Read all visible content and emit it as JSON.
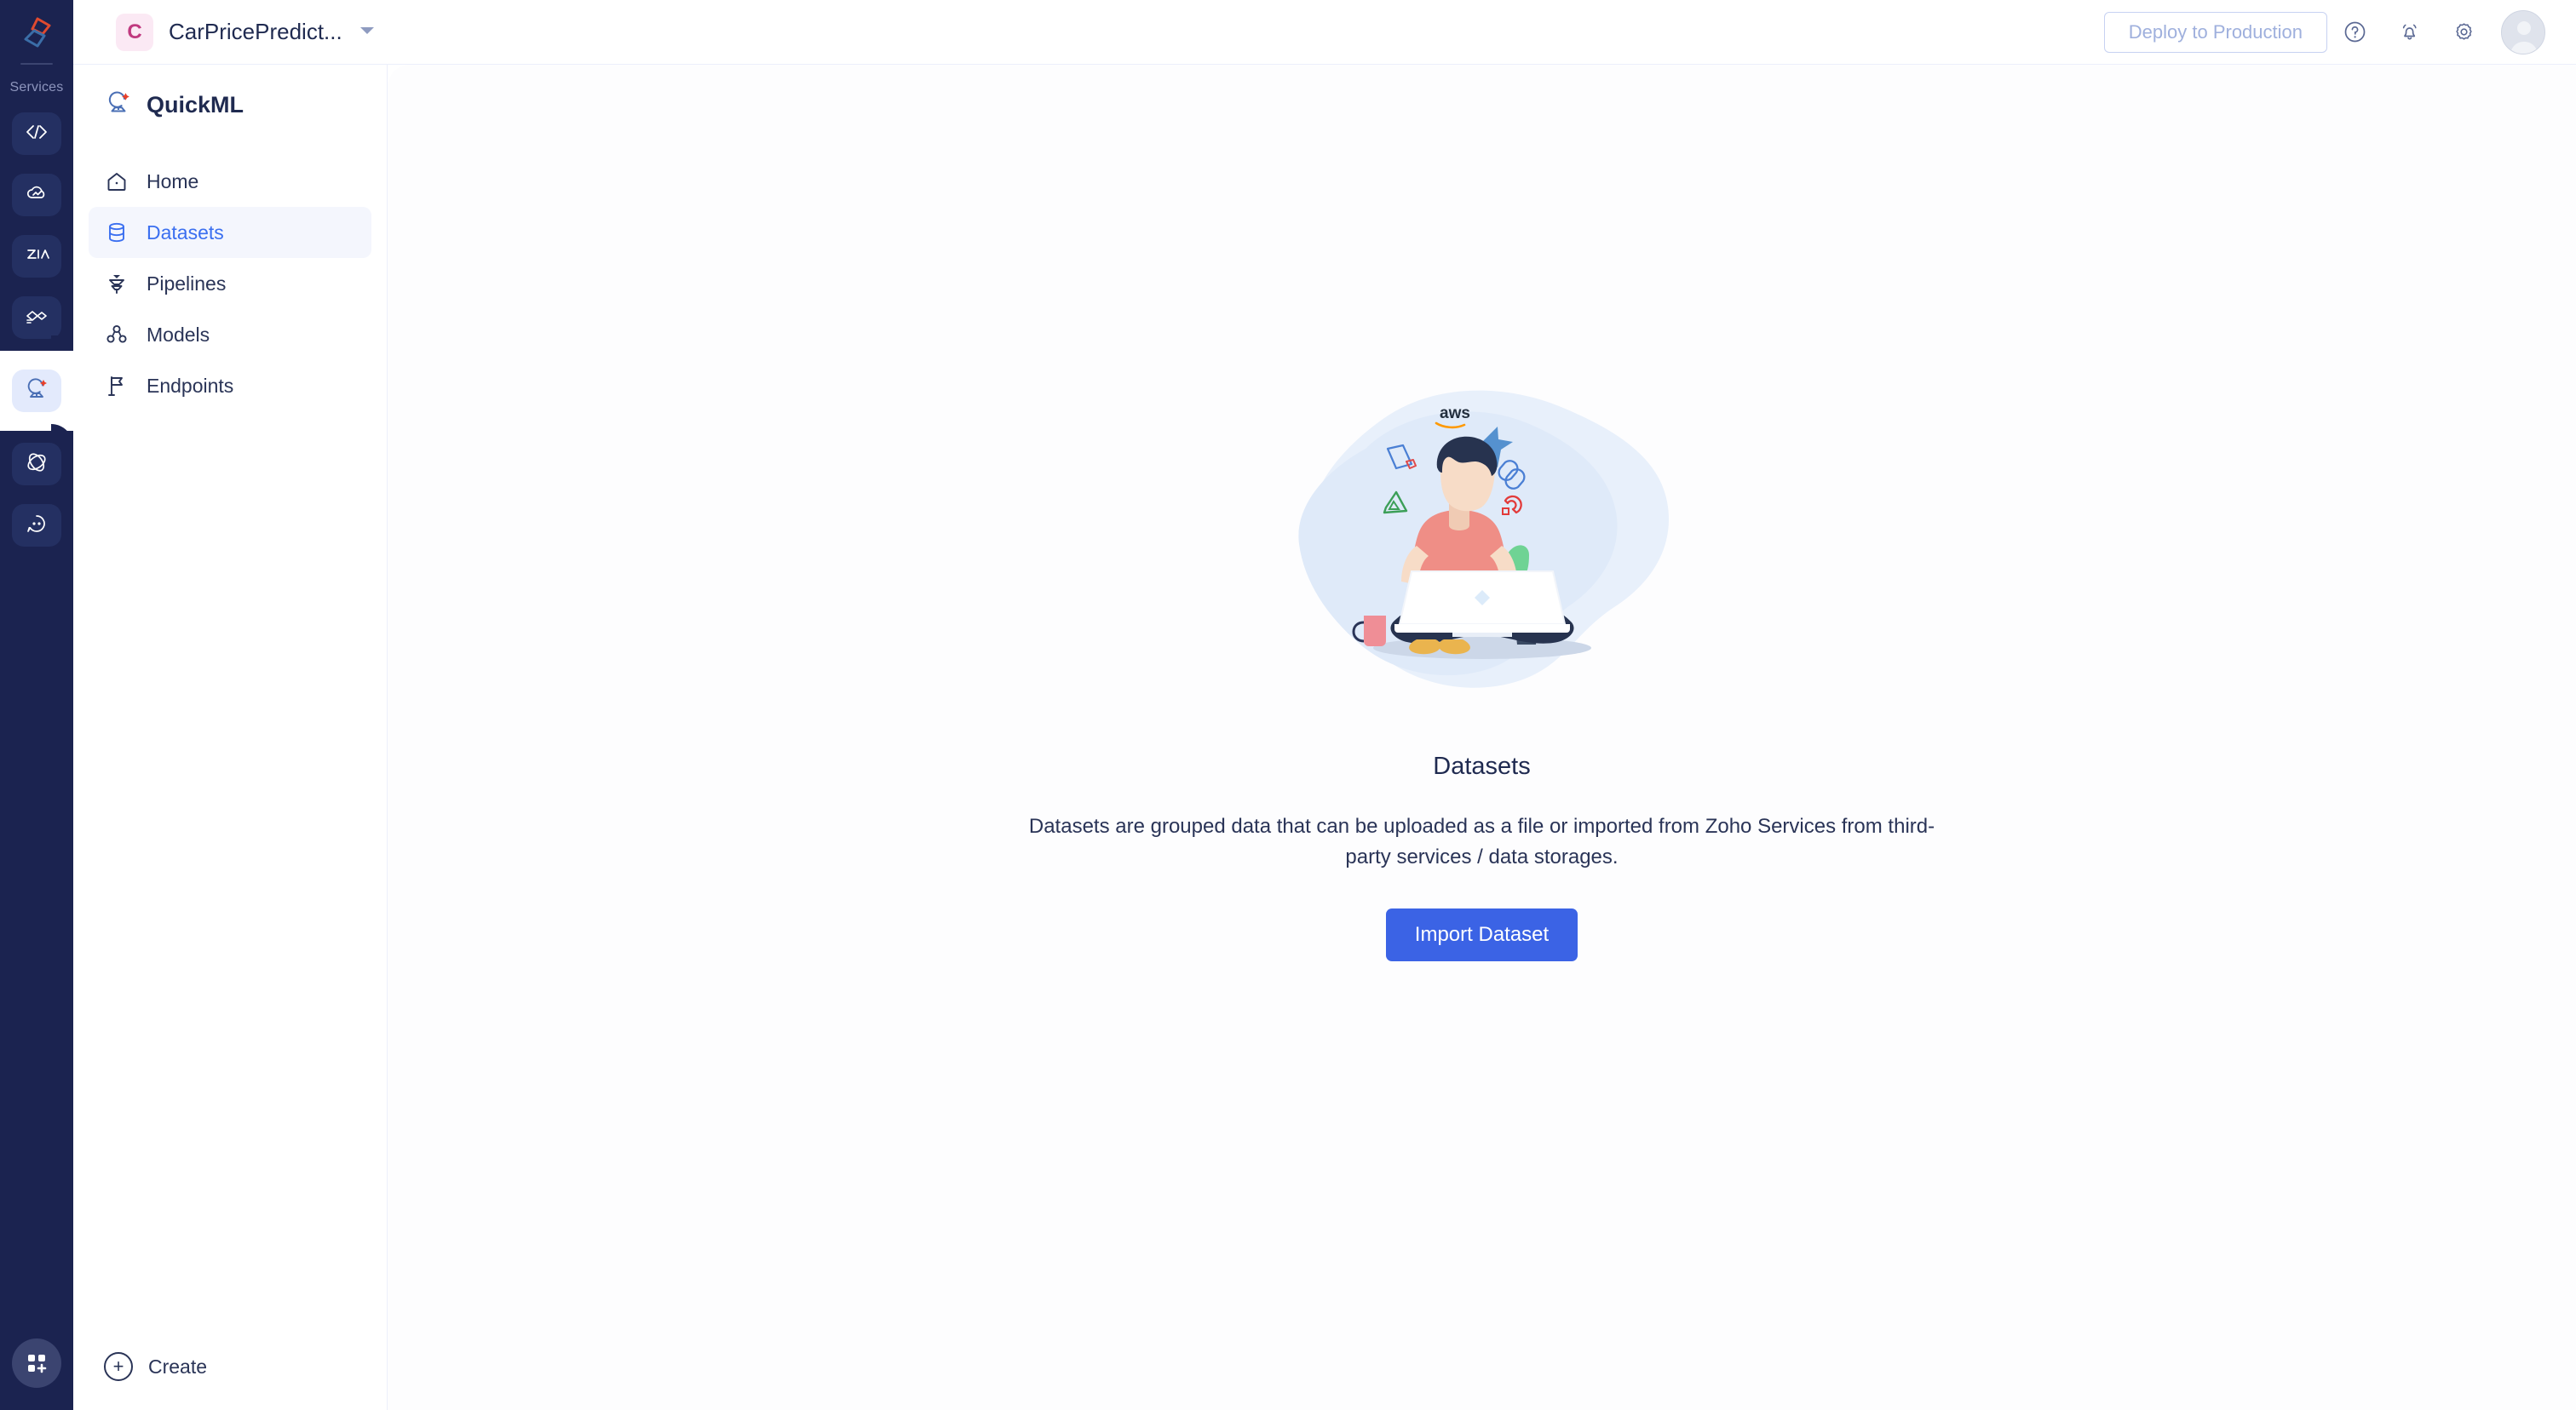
{
  "rail": {
    "logo_icon": "zoho-logo-icon",
    "services_label": "Services",
    "items": [
      {
        "icon": "code-brackets-icon",
        "active": false
      },
      {
        "icon": "cloud-analytics-icon",
        "active": false
      },
      {
        "icon": "zia-icon",
        "active": false
      },
      {
        "icon": "flow-connect-icon",
        "active": false
      },
      {
        "icon": "quickml-icon",
        "active": true
      },
      {
        "icon": "orbit-icon",
        "active": false
      },
      {
        "icon": "chat-bot-icon",
        "active": false
      }
    ],
    "bottom_icon": "app-grid-add-icon"
  },
  "header": {
    "org_initial": "C",
    "org_name": "CarPricePredict...",
    "org_caret_icon": "chevron-down-icon",
    "deploy_label": "Deploy to Production",
    "help_icon": "help-circle-icon",
    "bell_icon": "notification-bell-icon",
    "gear_icon": "settings-gear-icon",
    "avatar_icon": "user-avatar-icon"
  },
  "sidebar": {
    "brand_icon": "quickml-logo-icon",
    "brand_name": "QuickML",
    "items": [
      {
        "label": "Home",
        "icon": "home-icon",
        "active": false
      },
      {
        "label": "Datasets",
        "icon": "database-icon",
        "active": true
      },
      {
        "label": "Pipelines",
        "icon": "pipeline-icon",
        "active": false
      },
      {
        "label": "Models",
        "icon": "models-icon",
        "active": false
      },
      {
        "label": "Endpoints",
        "icon": "flag-icon",
        "active": false
      }
    ],
    "create_label": "Create",
    "create_icon": "plus-circle-icon"
  },
  "main": {
    "illustration_name": "person-with-laptop-cloud-services-illustration",
    "illustration_icons": [
      "aws-logo",
      "telegram-plane-logo",
      "file-shield-logo",
      "google-cloud-logo",
      "link-chain-logo",
      "azure-logo",
      "magnet-logo"
    ],
    "title": "Datasets",
    "description": "Datasets are grouped data that can be uploaded as a file or imported from Zoho Services from third-party services / data storages.",
    "import_button_label": "Import Dataset"
  },
  "colors": {
    "rail_bg": "#1b2350",
    "accent_blue": "#3b63e5",
    "nav_active_text": "#3b6ff0",
    "nav_active_bg": "#f4f6fd",
    "org_badge_bg": "#fbe9f4",
    "org_badge_text": "#c0397f",
    "text_primary": "#1f2a50",
    "deploy_disabled_text": "#9fb0dd"
  }
}
